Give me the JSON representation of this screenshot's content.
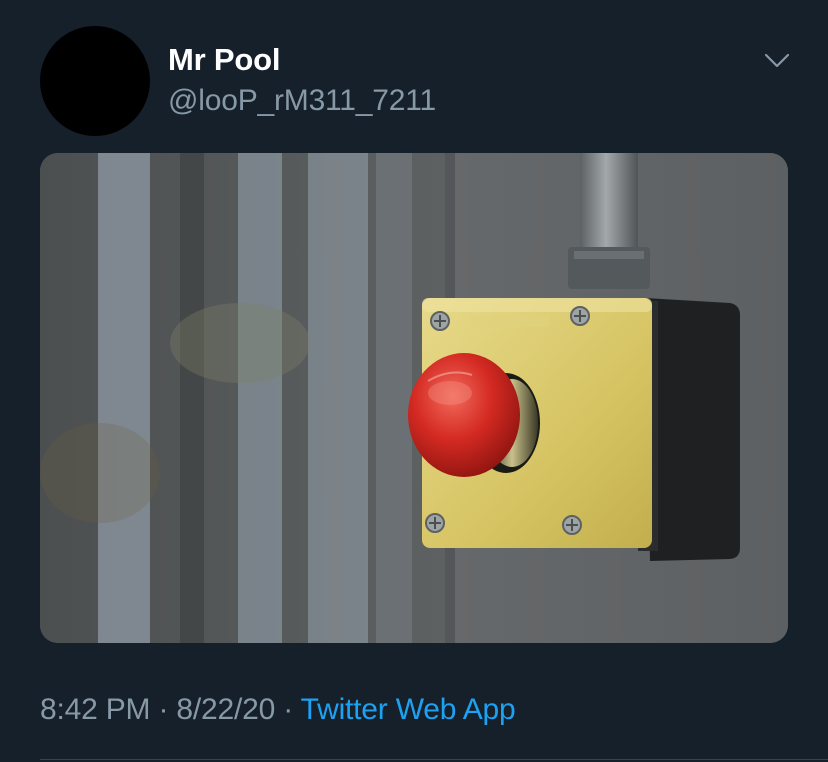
{
  "tweet": {
    "display_name": "Mr Pool",
    "handle": "@looP_rM311_7211",
    "time": "8:42 PM",
    "date": "8/22/20",
    "separator": "·",
    "source": "Twitter Web App",
    "menu_icon": "chevron-down-icon",
    "media_alt_icon": "emergency-stop-button-photo"
  },
  "colors": {
    "background": "#15202b",
    "secondary_text": "#8899a6",
    "link": "#1da1f2",
    "primary_text": "#ffffff"
  }
}
